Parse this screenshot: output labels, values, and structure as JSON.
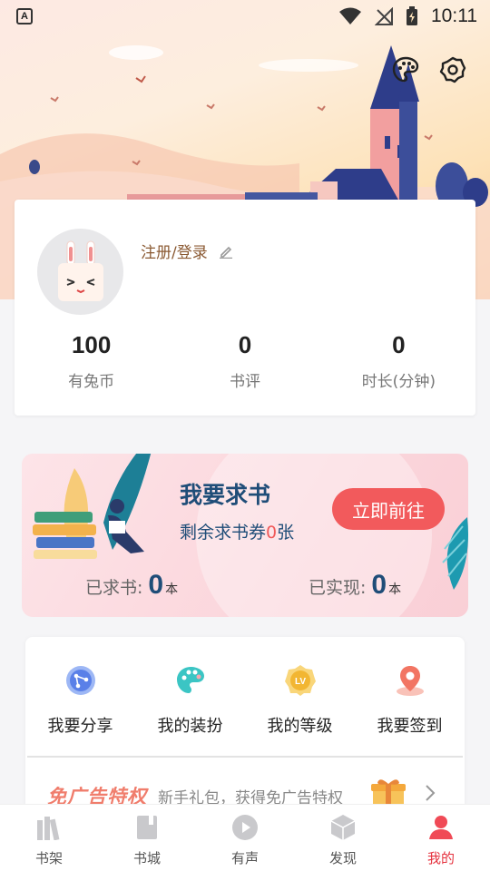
{
  "status_bar": {
    "time": "10:11",
    "notification_icon": "A"
  },
  "header": {
    "palette_icon": "palette-icon",
    "settings_icon": "settings-icon"
  },
  "profile": {
    "login_label": "注册/登录",
    "stats": [
      {
        "value": "100",
        "label": "有兔币"
      },
      {
        "value": "0",
        "label": "书评"
      },
      {
        "value": "0",
        "label": "时长(分钟)"
      }
    ]
  },
  "request_book": {
    "title": "我要求书",
    "sub_prefix": "剩余求书券",
    "sub_count": "0",
    "sub_suffix": "张",
    "button_label": "立即前往",
    "requested_label": "已求书:",
    "requested_value": "0",
    "requested_unit": "本",
    "fulfilled_label": "已实现:",
    "fulfilled_value": "0",
    "fulfilled_unit": "本"
  },
  "functions": [
    {
      "label": "我要分享",
      "icon": "share-icon"
    },
    {
      "label": "我的装扮",
      "icon": "palette-icon"
    },
    {
      "label": "我的等级",
      "icon": "level-icon"
    },
    {
      "label": "我要签到",
      "icon": "checkin-icon"
    }
  ],
  "ad_privilege": {
    "title": "免广告特权",
    "description": "新手礼包，获得免广告特权"
  },
  "bottom_nav": [
    {
      "label": "书架",
      "icon": "bookshelf-icon",
      "active": false
    },
    {
      "label": "书城",
      "icon": "bookstore-icon",
      "active": false
    },
    {
      "label": "有声",
      "icon": "audio-icon",
      "active": false
    },
    {
      "label": "发现",
      "icon": "discover-icon",
      "active": false
    },
    {
      "label": "我的",
      "icon": "profile-icon",
      "active": true
    }
  ],
  "colors": {
    "accent": "#e5323e",
    "button": "#f25a5c",
    "title_blue": "#1f4d78",
    "login_brown": "#8b5a33"
  }
}
